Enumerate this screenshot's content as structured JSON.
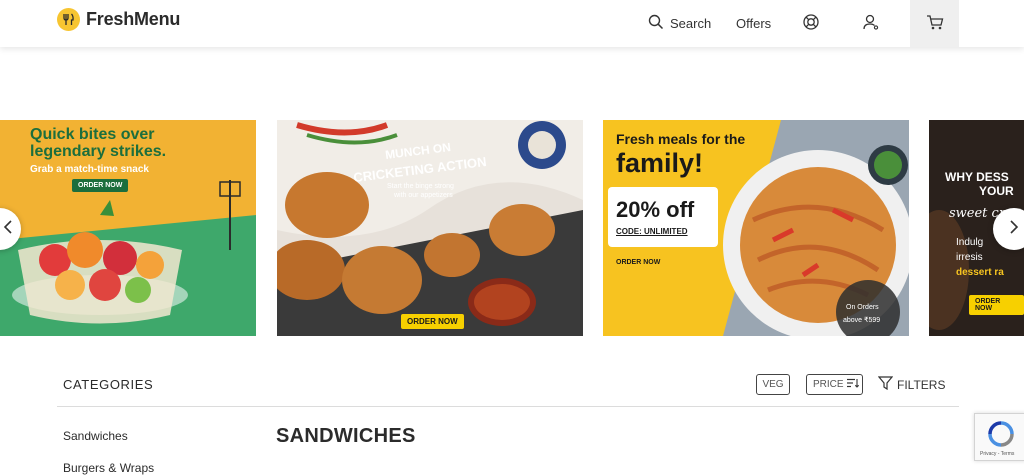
{
  "header": {
    "brand": "FreshMenu",
    "search_label": "Search",
    "offers_label": "Offers",
    "icons": {
      "search": "search-icon",
      "help": "lifebuoy-icon",
      "account": "user-icon",
      "cart": "cart-icon"
    }
  },
  "banners": [
    {
      "headline": "Quick bites over legendary strikes.",
      "sub": "Grab a match-time snack",
      "cta": "ORDER NOW"
    },
    {
      "headline_line1": "MUNCH ON",
      "headline_line2": "CRICKETING ACTION",
      "sub_line1": "Start the binge strong",
      "sub_line2": "with our appetizers",
      "cta": "ORDER NOW"
    },
    {
      "headline_line1": "Fresh meals for the",
      "headline_line2": "family!",
      "discount": "20% off",
      "code": "CODE: UNLIMITED",
      "cta": "ORDER NOW",
      "note_line1": "On Orders",
      "note_line2": "above ₹599"
    },
    {
      "line1": "WHY DESS",
      "line2": "YOUR",
      "line3": "sweet cr",
      "line4": "Indulg",
      "line5": "irresis",
      "line6": "dessert ra",
      "cta": "ORDER NOW"
    }
  ],
  "filters": {
    "categories_title": "CATEGORIES",
    "veg_label": "VEG",
    "price_label": "PRICE",
    "filters_label": "FILTERS"
  },
  "sidebar": {
    "items": [
      "Sandwiches",
      "Burgers & Wraps"
    ]
  },
  "section": {
    "title": "SANDWICHES"
  },
  "recaptcha": {
    "footer": "Privacy - Terms"
  },
  "colors": {
    "brand_yellow": "#f7c531",
    "banner1_bg": "#f2b233",
    "banner1_green": "#3ea86b",
    "cta_yellow": "#f7d000",
    "header_cart_bg": "#efefef"
  }
}
